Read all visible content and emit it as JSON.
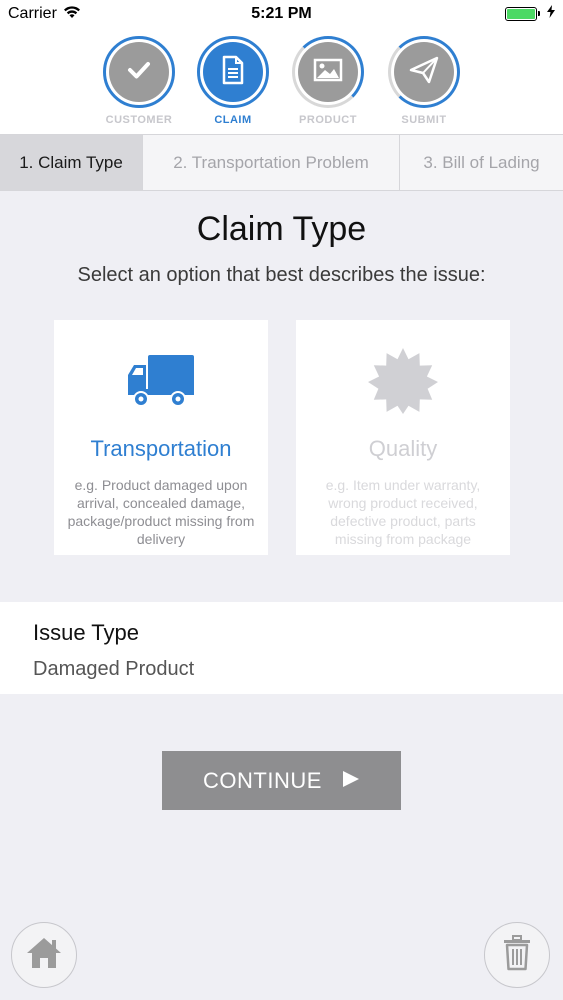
{
  "status_bar": {
    "carrier": "Carrier",
    "time": "5:21 PM",
    "battery_percent": 100
  },
  "steps": [
    {
      "label": "CUSTOMER",
      "icon": "checkmark-icon",
      "state": "done"
    },
    {
      "label": "CLAIM",
      "icon": "document-icon",
      "state": "active"
    },
    {
      "label": "PRODUCT",
      "icon": "image-icon",
      "state": "pending"
    },
    {
      "label": "SUBMIT",
      "icon": "paper-plane-icon",
      "state": "pending"
    }
  ],
  "tabs": [
    {
      "label": "1. Claim Type",
      "active": true
    },
    {
      "label": "2. Transportation Problem",
      "active": false
    },
    {
      "label": "3. Bill of Lading",
      "active": false
    }
  ],
  "main": {
    "title": "Claim Type",
    "subtitle": "Select an option that best describes the issue:"
  },
  "options": [
    {
      "title": "Transportation",
      "icon": "truck-icon",
      "selected": true,
      "description": "e.g. Product damaged upon arrival, concealed damage, package/product missing from delivery"
    },
    {
      "title": "Quality",
      "icon": "badge-icon",
      "selected": false,
      "description": "e.g. Item under warranty, wrong product received, defective product, parts missing from package"
    }
  ],
  "issue": {
    "label": "Issue Type",
    "value": "Damaged Product"
  },
  "actions": {
    "continue_label": "CONTINUE"
  },
  "colors": {
    "accent": "#2f7fd1",
    "inactive_step": "#9b9b9b",
    "button": "#8e8e90",
    "background": "#efeff4"
  }
}
